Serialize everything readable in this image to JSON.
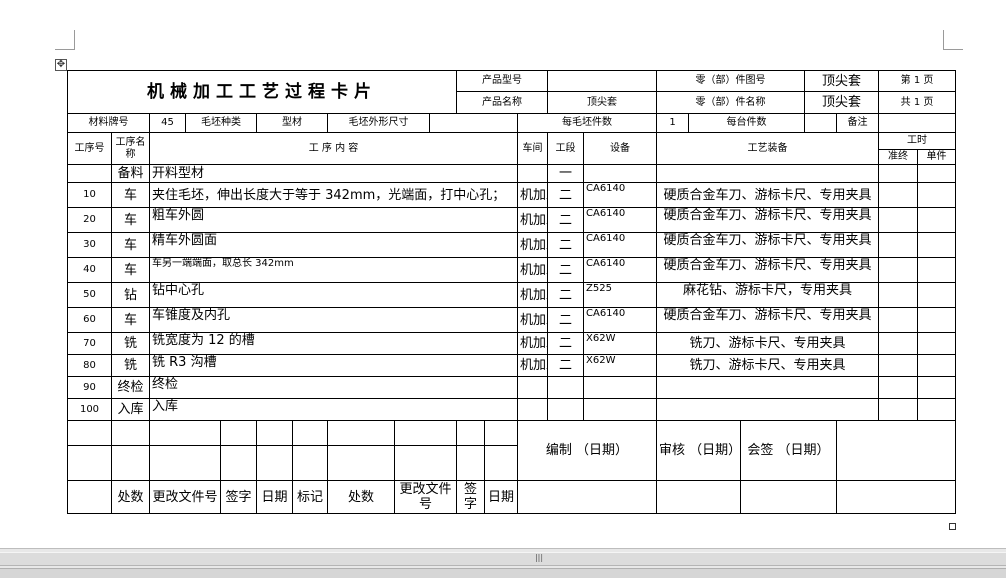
{
  "card": {
    "title": "机械加工工艺过程卡片",
    "product_model_label": "产品型号",
    "product_model_value": "",
    "part_drawing_label": "零（部）件图号",
    "part_drawing_value": "顶尖套",
    "page_label": "第 1 页",
    "product_name_label": "产品名称",
    "product_name_value": "顶尖套",
    "part_name_label": "零（部）件名称",
    "part_name_value": "顶尖套",
    "total_pages_label": "共 1 页"
  },
  "material": {
    "grade_label": "材料牌号",
    "grade_value": "45",
    "blank_type_label": "毛坯种类",
    "blank_type_value": "型材",
    "blank_size_label": "毛坯外形尺寸",
    "blank_size_value": "",
    "blanks_per_label": "每毛坯件数",
    "blanks_per_value": "1",
    "units_per_label": "每台件数",
    "units_per_value": "",
    "remarks_label": "备注",
    "remarks_value": ""
  },
  "headers": {
    "op_no": "工序号",
    "op_name": "工序名称",
    "op_content": "工 序 内 容",
    "workshop": "车间",
    "section": "工段",
    "equipment": "设备",
    "tooling": "工艺装备",
    "hours": "工时",
    "prep": "准终",
    "unit": "单件"
  },
  "rows": [
    {
      "no": "",
      "name": "备料",
      "content": "开料型材",
      "shop": "",
      "section": "一",
      "equip": "",
      "tooling": ""
    },
    {
      "no": "10",
      "name": "车",
      "content": "夹住毛坯，伸出长度大于等于 342mm，光端面，打中心孔；",
      "shop": "机加工",
      "section": "二",
      "equip": "CA6140",
      "tooling": "硬质合金车刀、游标卡尺、专用夹具"
    },
    {
      "no": "20",
      "name": "车",
      "content": "粗车外圆",
      "shop": "机加工",
      "section": "二",
      "equip": "CA6140",
      "tooling": "硬质合金车刀、游标卡尺、专用夹具"
    },
    {
      "no": "30",
      "name": "车",
      "content": "精车外圆面",
      "shop": "机加工",
      "section": "二",
      "equip": "CA6140",
      "tooling": "硬质合金车刀、游标卡尺、专用夹具"
    },
    {
      "no": "40",
      "name": "车",
      "content": "车另一端端面，取总长 342mm",
      "shop": "机加工",
      "section": "二",
      "equip": "CA6140",
      "tooling": "硬质合金车刀、游标卡尺、专用夹具"
    },
    {
      "no": "50",
      "name": "钻",
      "content": "钻中心孔",
      "shop": "机加工",
      "section": "二",
      "equip": "Z525",
      "tooling": "麻花钻、游标卡尺，专用夹具"
    },
    {
      "no": "60",
      "name": "车",
      "content": "车锥度及内孔",
      "shop": "机加工",
      "section": "二",
      "equip": "CA6140",
      "tooling": "硬质合金车刀、游标卡尺、专用夹具"
    },
    {
      "no": "70",
      "name": "铣",
      "content": "铣宽度为 12 的槽",
      "shop": "机加工",
      "section": "二",
      "equip": "X62W",
      "tooling": "铣刀、游标卡尺、专用夹具"
    },
    {
      "no": "80",
      "name": "铣",
      "content": "铣 R3 沟槽",
      "shop": "机加工",
      "section": "二",
      "equip": "X62W",
      "tooling": "铣刀、游标卡尺、专用夹具"
    },
    {
      "no": "90",
      "name": "终检",
      "content": "终检",
      "shop": "",
      "section": "",
      "equip": "",
      "tooling": ""
    },
    {
      "no": "100",
      "name": "入库",
      "content": "入库",
      "shop": "",
      "section": "",
      "equip": "",
      "tooling": ""
    }
  ],
  "signoff": {
    "compile": "编制 （日期）",
    "review": "审核 （日期）",
    "countersign": "会签 （日期）",
    "rev_place": "处数",
    "rev_doc": "更改文件号",
    "rev_sign": "签字",
    "rev_date": "日期",
    "mark": "标记"
  }
}
